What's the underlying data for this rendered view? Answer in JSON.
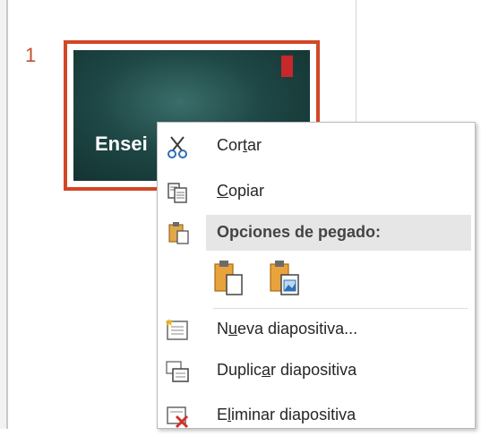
{
  "slide_panel": {
    "slide_number": "1",
    "thumbnail_title": "Ensei"
  },
  "context_menu": {
    "items": [
      {
        "before": "Cor",
        "ul": "t",
        "after": "ar"
      },
      {
        "before": "",
        "ul": "C",
        "after": "opiar"
      },
      {
        "before": "N",
        "ul": "u",
        "after": "eva diapositiva..."
      },
      {
        "before": "Duplic",
        "ul": "a",
        "after": "r diapositiva"
      },
      {
        "before": "E",
        "ul": "l",
        "after": "iminar diapositiva"
      }
    ],
    "paste_options_header": "Opciones de pegado:"
  },
  "colors": {
    "accent_border": "#d24726",
    "highlight_border": "#f47a20",
    "slide_background": "#1e4745"
  }
}
